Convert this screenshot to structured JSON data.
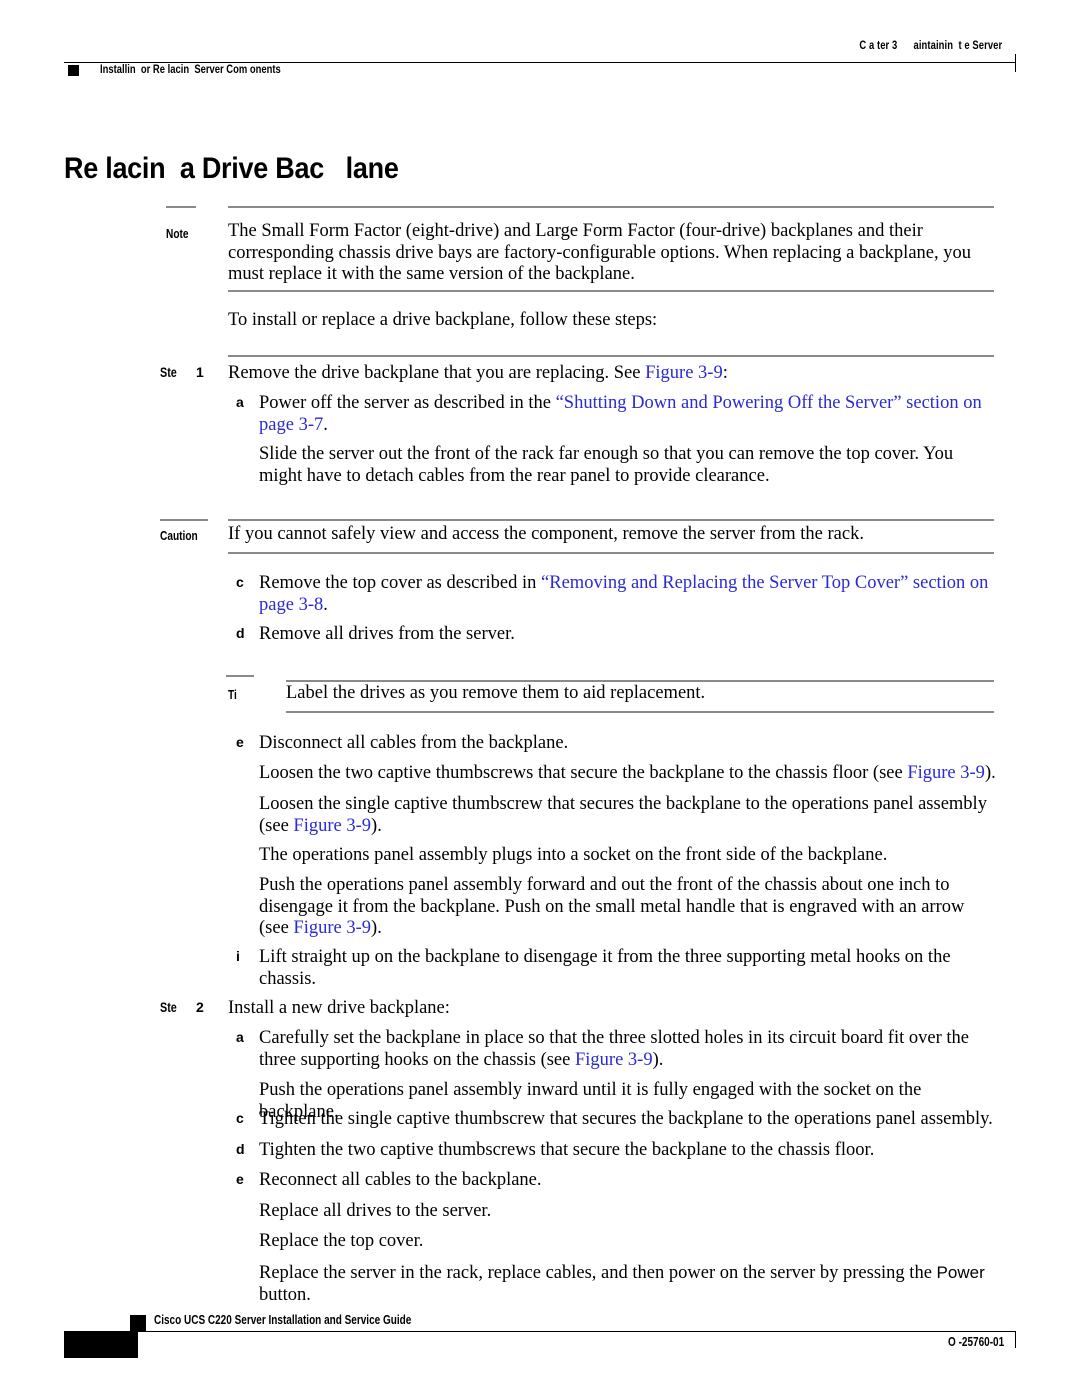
{
  "header": {
    "chapter_text": "C a ter 3      aintainin  t e Server",
    "section_text": "Installin  or Re lacin  Server Com onents"
  },
  "title": "Re lacin  a Drive Bac   lane",
  "note": {
    "label": "Note",
    "text": "The Small Form Factor (eight-drive) and Large Form Factor (four-drive) backplanes and their corresponding chassis drive bays are factory-configurable options. When replacing a backplane, you must replace it with the same version of the backplane."
  },
  "intro": "To install or replace a drive backplane, follow these steps:",
  "step1": {
    "label": "Ste",
    "number": "1",
    "text_before_link": "Remove the drive backplane that you are replacing. See ",
    "link": "Figure",
    "link_ref": "3-9",
    "text_after": ":"
  },
  "step1a": {
    "letter": "a",
    "text_1": "Power off the server as described in the ",
    "link_1": "“Shutting Down and Powering Off the Server” section on",
    "link_2": "page",
    "link_2_ref": "3-7",
    "text_2": "."
  },
  "step1b": {
    "text": "Slide the server out the front of the rack far enough so that you can remove the top cover. You might have to detach cables from the rear panel to provide clearance."
  },
  "caution": {
    "label": "Caution",
    "text": "If you cannot safely view and access the component, remove the server from the rack."
  },
  "step1c": {
    "letter": "c",
    "text_1": "Remove the top cover as described in ",
    "link_1": "“Removing and Replacing the Server Top Cover” section on",
    "link_2": "page",
    "link_2_ref": "3-8",
    "text_2": "."
  },
  "step1d": {
    "letter": "d",
    "text": "Remove all drives from the server."
  },
  "tip": {
    "label": "Ti",
    "text": "Label the drives as you remove them to aid replacement."
  },
  "step1e": {
    "letter": "e",
    "text": "Disconnect all cables from the backplane."
  },
  "step1f": {
    "text_1": "Loosen the two captive thumbscrews that secure the backplane to the chassis floor (see ",
    "link": "Figure",
    "link_ref": "3-9",
    "text_2": ")."
  },
  "step1g": {
    "text_1": "Loosen the single captive thumbscrew that secures the backplane to the operations panel assembly (see ",
    "link": "Figure",
    "link_ref": "3-9",
    "text_2": ")."
  },
  "step1h": {
    "text": "The operations panel assembly plugs into a socket on the front side of the backplane."
  },
  "step1h2": {
    "text_1": "Push the operations panel assembly forward and out the front of the chassis about one inch to disengage it from the backplane. Push on the small metal handle that is engraved with an arrow (see ",
    "link": "Figure",
    "link_ref": "3-9",
    "text_2": ")."
  },
  "step1i": {
    "letter": "i",
    "text": "Lift straight up on the backplane to disengage it from the three supporting metal hooks on the chassis."
  },
  "step2": {
    "label": "Ste",
    "number": "2",
    "text": "Install a new drive backplane:"
  },
  "step2a": {
    "letter": "a",
    "text_1": "Carefully set the backplane in place so that the three slotted holes in its circuit board fit over the three supporting hooks on the chassis (see ",
    "link": "Figure",
    "link_ref": "3-9",
    "text_2": ")."
  },
  "step2b": {
    "text": "Push the operations panel assembly inward until it is fully engaged with the socket on the backplane."
  },
  "step2c": {
    "letter": "c",
    "text": "Tighten the single captive thumbscrew that secures the backplane to the operations panel assembly."
  },
  "step2d": {
    "letter": "d",
    "text": "Tighten the two captive thumbscrews that secure the backplane to the chassis floor."
  },
  "step2e": {
    "letter": "e",
    "text": "Reconnect all cables to the backplane."
  },
  "step2f": {
    "text": "Replace all drives to the server."
  },
  "step2g": {
    "text": "Replace the top cover."
  },
  "step2h": {
    "text_1": "Replace the server in the rack, replace cables, and then power on the server by pressing the ",
    "button": "Power",
    "text_2": " button."
  },
  "footer": {
    "doc_title": "Cisco UCS C220 Server Installation and Service Guide",
    "doc_id": "O -25760-01"
  },
  "colors": {
    "link": "#2a2ad4",
    "rule_gray": "#8a8a8a",
    "text": "#000000"
  }
}
